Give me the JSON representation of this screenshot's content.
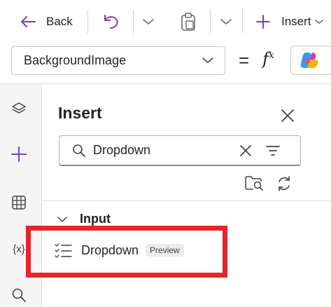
{
  "toolbar": {
    "back_label": "Back",
    "insert_label": "Insert"
  },
  "formula_bar": {
    "property": "BackgroundImage",
    "equals": "=",
    "fx": "f",
    "fx_sup": "x"
  },
  "insert_panel": {
    "title": "Insert",
    "search_value": "Dropdown",
    "group_label": "Input",
    "item_label": "Dropdown",
    "item_badge": "Preview"
  },
  "rail": {
    "variables_label": "{x}"
  },
  "colors": {
    "accent": "#7b3fbf",
    "highlight": "#e8232a"
  }
}
